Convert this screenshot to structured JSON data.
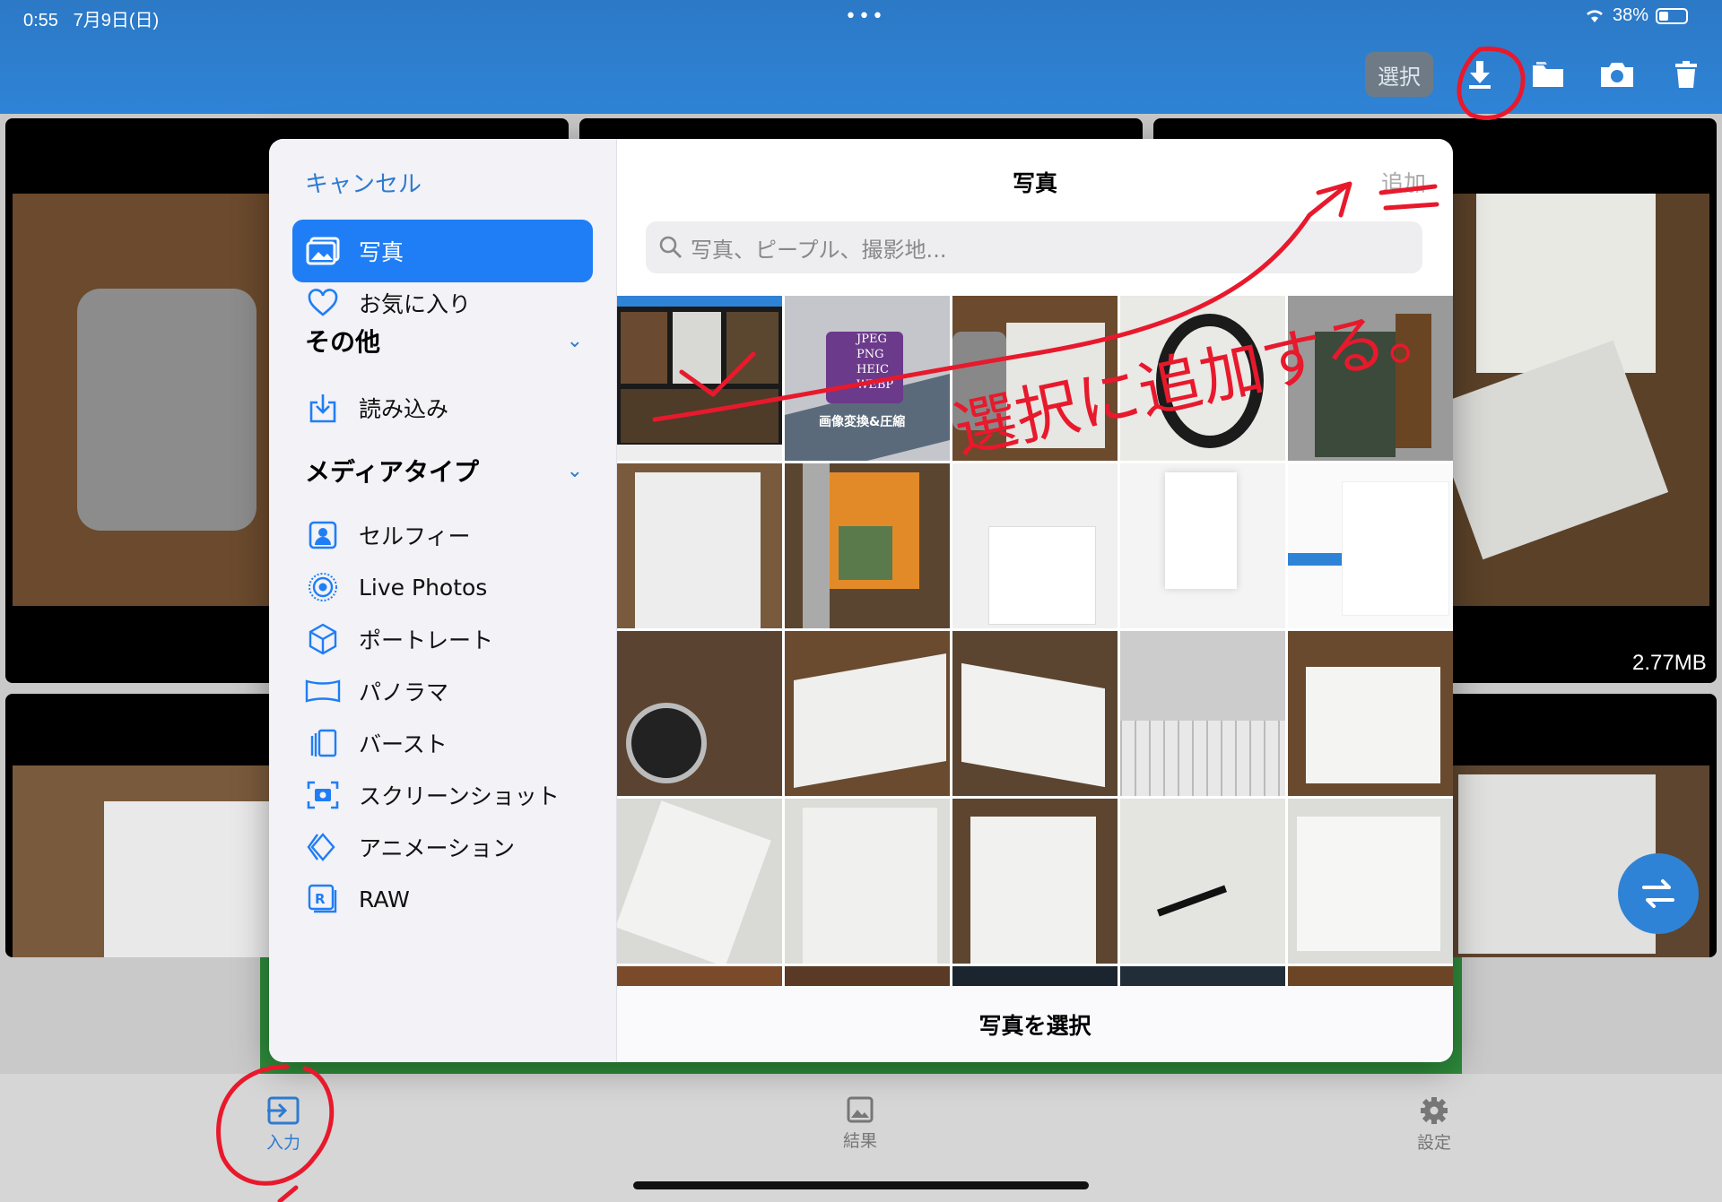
{
  "status": {
    "time": "0:55",
    "date": "7月9日(日)",
    "battery": "38%",
    "dots": "•••"
  },
  "toolbar": {
    "select_label": "選択",
    "icons": [
      "download-icon",
      "folder-icon",
      "camera-icon",
      "trash-icon"
    ]
  },
  "background": {
    "size_label": "2.77MB"
  },
  "sheet": {
    "cancel": "キャンセル",
    "title": "写真",
    "add": "追加",
    "search_placeholder": "写真、ピープル、撮影地...",
    "footer": "写真を選択",
    "sidebar": {
      "photos": "写真",
      "favorites": "お気に入り",
      "others_header": "その他",
      "imports": "読み込み",
      "media_header": "メディアタイプ",
      "media": [
        "セルフィー",
        "Live Photos",
        "ポートレート",
        "パノラマ",
        "バースト",
        "スクリーンショット",
        "アニメーション",
        "RAW"
      ]
    },
    "thumb_text": {
      "formats": [
        "JPEG",
        "PNG",
        "HEIC",
        "WEBP"
      ],
      "caption": "画像変換&圧縮"
    }
  },
  "annotation": {
    "text": "選択に追加する。"
  },
  "tabs": {
    "input": "入力",
    "result": "結果",
    "settings": "設定"
  },
  "colors": {
    "accent": "#1f7ef5",
    "topbar": "#2f83d6",
    "annotation": "#e8192c"
  }
}
